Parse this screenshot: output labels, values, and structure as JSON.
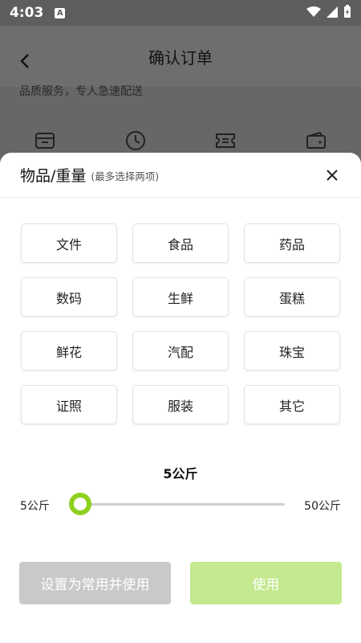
{
  "status_bar": {
    "time": "4:03",
    "notification_letter": "A"
  },
  "nav": {
    "title": "确认订单"
  },
  "background": {
    "text": "品质服务，专人急速配送"
  },
  "sheet": {
    "title": "物品/重量",
    "subtitle": "(最多选择两项)",
    "items": [
      "文件",
      "食品",
      "药品",
      "数码",
      "生鲜",
      "蛋糕",
      "鲜花",
      "汽配",
      "珠宝",
      "证照",
      "服装",
      "其它"
    ]
  },
  "weight": {
    "value_label": "5公斤",
    "min_label": "5公斤",
    "max_label": "50公斤",
    "current": 5,
    "min": 5,
    "max": 50
  },
  "buttons": {
    "save_and_use": "设置为常用并使用",
    "use": "使用"
  },
  "colors": {
    "accent": "#8fd021",
    "use_button": "#c4e98f",
    "save_button": "#c9c9c9"
  }
}
